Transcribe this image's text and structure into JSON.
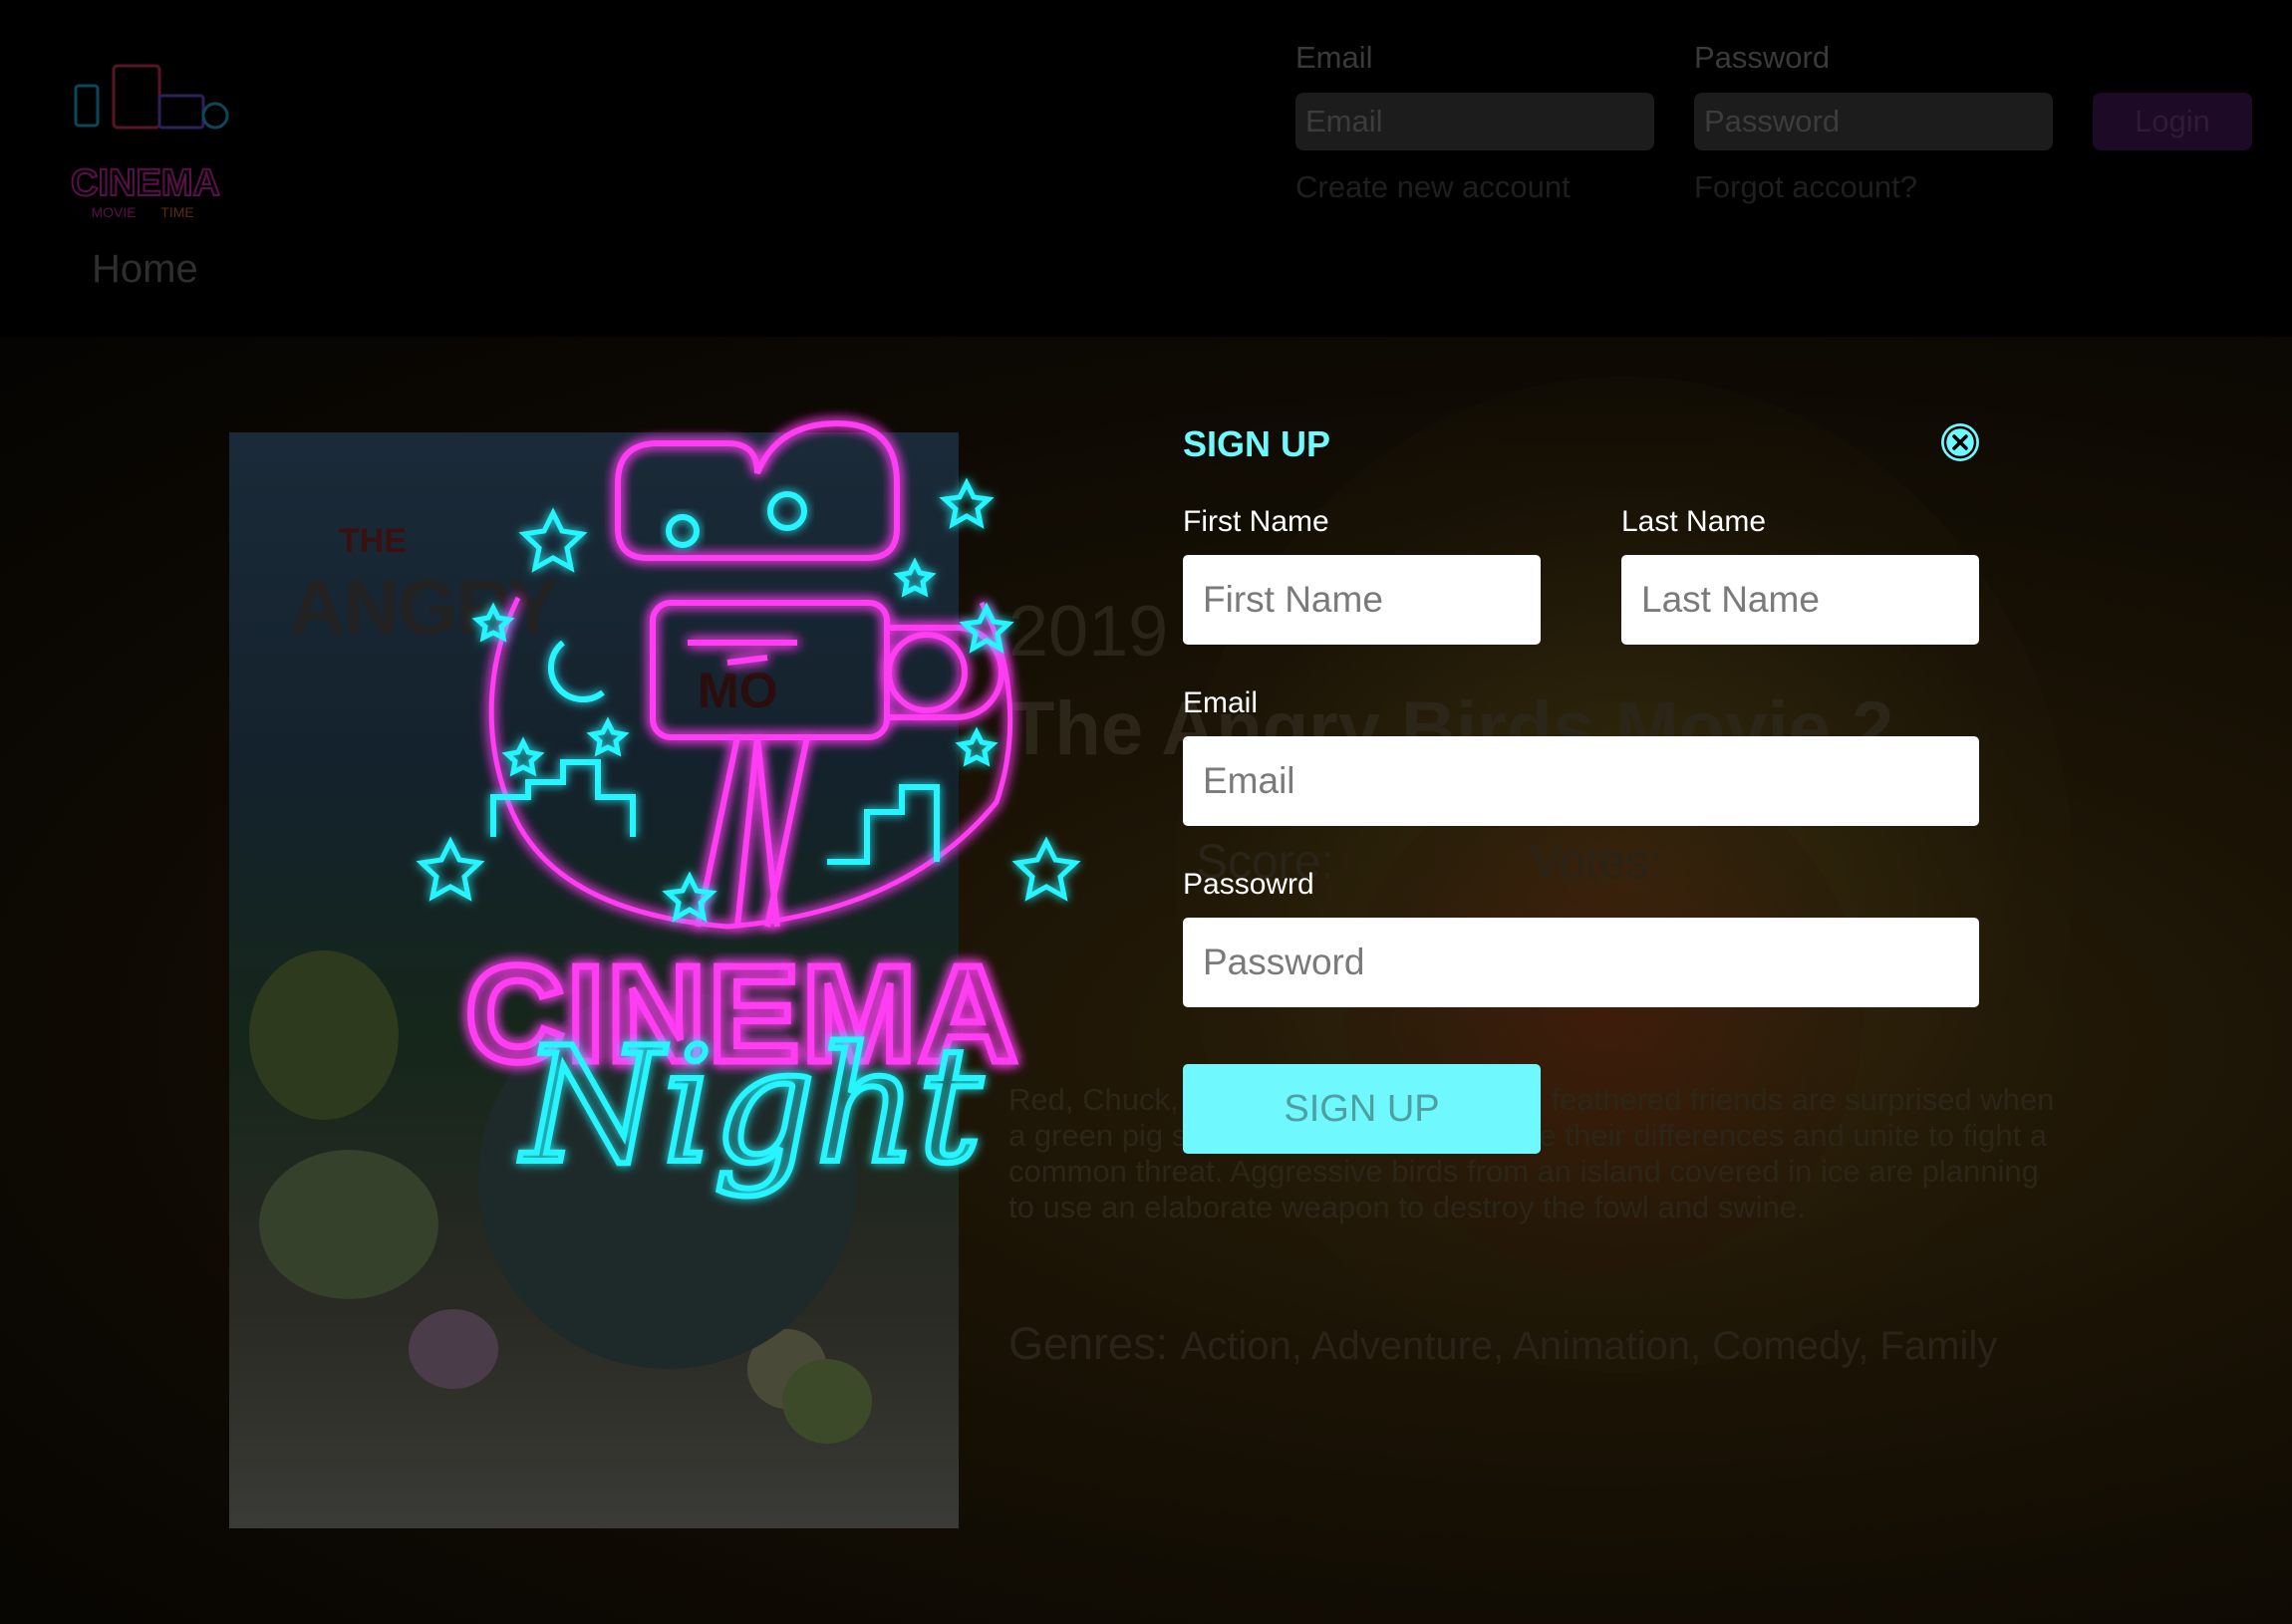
{
  "header": {
    "logo_text": "CINEMA",
    "logo_sub_left": "MOVIE",
    "logo_sub_right": "TIME",
    "nav_home": "Home",
    "login": {
      "email_label": "Email",
      "email_placeholder": "Email",
      "password_label": "Password",
      "password_placeholder": "Password",
      "login_button": "Login",
      "create_account": "Create new account",
      "forgot_account": "Forgot account?"
    }
  },
  "movie": {
    "poster_title": "ANGRY",
    "poster_the": "THE",
    "poster_movie": "MO",
    "year": "2019",
    "title": "The Angry Birds Movie 2",
    "score_label": "Score:",
    "votes_label": "Votes:",
    "description": "Red, Chuck, Bomb and the rest of their feathered friends are surprised when a green pig suggests that they put aside their differences and unite to fight a common threat. Aggressive birds from an island covered in ice are planning to use an elaborate weapon to destroy the fowl and swine.",
    "genres_label": "Genres:",
    "genres": "Action, Adventure, Animation, Comedy, Family"
  },
  "modal": {
    "neon_cinema": "CINEMA",
    "neon_night": "Night",
    "title": "SIGN UP",
    "first_name_label": "First Name",
    "first_name_placeholder": "First Name",
    "last_name_label": "Last Name",
    "last_name_placeholder": "Last Name",
    "email_label": "Email",
    "email_placeholder": "Email",
    "password_label": "Passowrd",
    "password_placeholder": "Password",
    "submit_label": "SIGN UP"
  },
  "colors": {
    "accent_cyan": "#6ff8fe",
    "neon_magenta": "#ff3cf2",
    "background": "#000000"
  },
  "icons": {
    "close": "close-icon",
    "logo": "cinema-logo-icon"
  }
}
